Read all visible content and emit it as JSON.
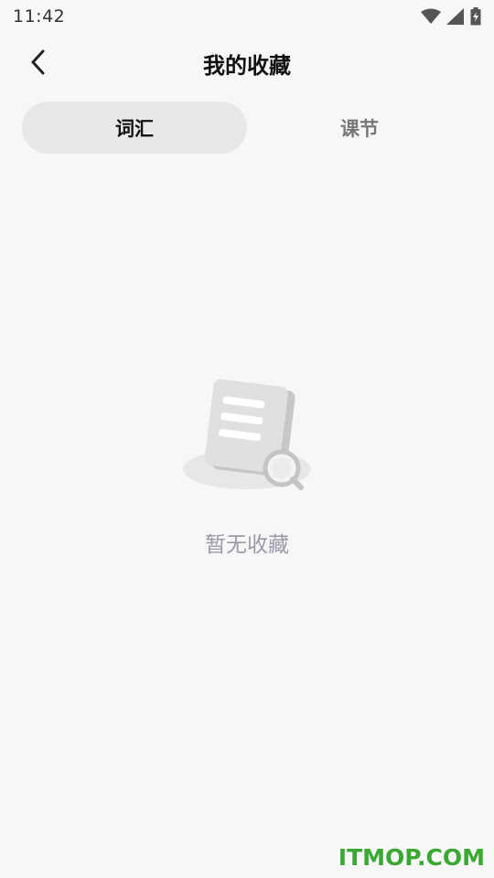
{
  "status_bar": {
    "time": "11:42",
    "icons": [
      "wifi-icon",
      "signal-icon",
      "battery-charging-icon"
    ]
  },
  "header": {
    "title": "我的收藏",
    "back_icon": "chevron-left-icon"
  },
  "tabs": [
    {
      "label": "词汇",
      "active": true
    },
    {
      "label": "课节",
      "active": false
    }
  ],
  "empty_state": {
    "icon": "empty-document-search-icon",
    "message": "暂无收藏"
  },
  "watermark": {
    "text": "ITMOP.COM",
    "color": "#3aa833"
  },
  "colors": {
    "background": "#f7f7f7",
    "active_tab": "#e8e8e8",
    "empty_text": "#999aa6"
  }
}
